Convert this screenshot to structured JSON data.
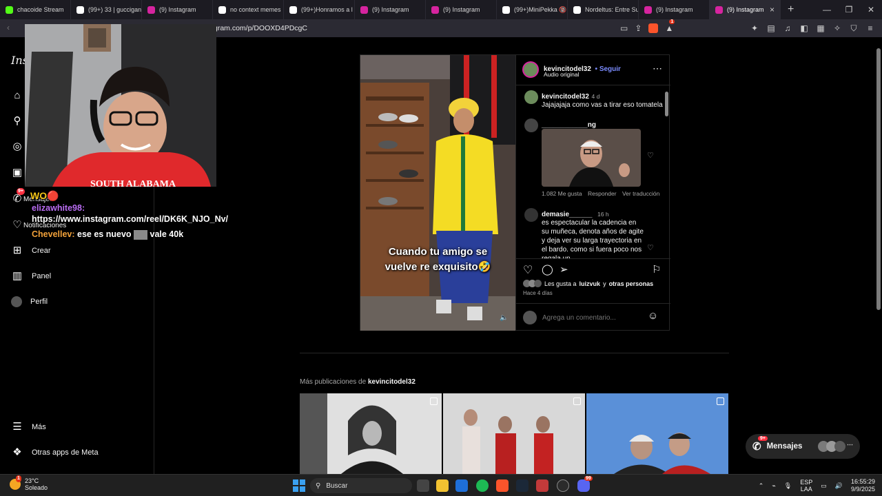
{
  "browser": {
    "tabs": [
      {
        "label": "chacoide Stream",
        "color": "#53fc18"
      },
      {
        "label": "(99+) 33 | guccigan",
        "color": "#ffffff"
      },
      {
        "label": "(9) Instagram",
        "color": "#d6249f"
      },
      {
        "label": "no context memes",
        "color": "#ffffff"
      },
      {
        "label": "(99+)Honramos a l",
        "color": "#ffffff"
      },
      {
        "label": "(9) Instagram",
        "color": "#d6249f"
      },
      {
        "label": "(9) Instagram",
        "color": "#d6249f"
      },
      {
        "label": "(99+)MiniPekka 🔞",
        "color": "#ffffff"
      },
      {
        "label": "Nordeltus: Entre Su",
        "color": "#ffffff"
      },
      {
        "label": "(9) Instagram",
        "color": "#d6249f"
      },
      {
        "label": "(9) Instagram",
        "color": "#d6249f",
        "active": true
      }
    ],
    "new_tab": "+",
    "url": "gram.com/p/DOOXD4PDcgC",
    "brave_badge": "1"
  },
  "sidebar": {
    "logo": "Ins",
    "items": [
      {
        "label": "",
        "icon": "home-icon",
        "glyph": "⌂"
      },
      {
        "label": "",
        "icon": "search-icon",
        "glyph": "⚲"
      },
      {
        "label": "",
        "icon": "explore-icon",
        "glyph": "◎"
      },
      {
        "label": "",
        "icon": "reels-icon",
        "glyph": "▣"
      },
      {
        "label": "Mensajes",
        "icon": "messages-icon",
        "glyph": "✆",
        "badge": "9+"
      },
      {
        "label": "Notificaciones",
        "icon": "heart-icon",
        "glyph": "♡"
      },
      {
        "label": "Crear",
        "icon": "create-icon",
        "glyph": "⊞"
      },
      {
        "label": "Panel",
        "icon": "dashboard-icon",
        "glyph": "▥"
      },
      {
        "label": "Perfil",
        "icon": "profile-avatar",
        "glyph": ""
      }
    ],
    "more": "Más",
    "meta_apps": "Otras apps de Meta"
  },
  "stream_chat": [
    {
      "user": "elizawhite98:",
      "msg": "https://www.instagram.com/reel/DK6K_NJO_Nv/"
    },
    {
      "user": "Chevellev:",
      "msg": "ese es nuevo",
      "msg2": "vale 40k"
    }
  ],
  "post": {
    "username": "kevincitodel32",
    "follow": "Seguir",
    "audio": "Audio original",
    "caption_overlay": [
      "Cuando tu amigo se",
      "vuelve re exquisito🤣"
    ],
    "comments": [
      {
        "user": "kevincitodel32",
        "time": "4 d",
        "text": "Jajajajaja como vas a tirar eso tomatela"
      },
      {
        "user": "____________ng",
        "likes": "1.082 Me gusta",
        "reply": "Responder",
        "translate": "Ver traducción"
      },
      {
        "user": "demasie______",
        "time": "16 h",
        "text": "es espectacular la cadencia en su muñeca, denota años de agite y deja ver su larga trayectoria en el bardo. como si fuera poco nos regala un"
      }
    ],
    "likes_prefix": "Les gusta a",
    "likes_user": "luizvuk",
    "likes_suffix": "y",
    "likes_others": "otras personas",
    "posted_ago": "Hace 4 días",
    "comment_placeholder": "Agrega un comentario..."
  },
  "more_posts": {
    "prefix": "Más publicaciones de",
    "user": "kevincitodel32"
  },
  "messages_pill": {
    "label": "Mensajes",
    "badge": "9+"
  },
  "taskbar": {
    "temp": "23°C",
    "weather": "Soleado",
    "weather_badge": "1",
    "search": "Buscar",
    "lang1": "ESP",
    "lang2": "LAA",
    "time": "16:55:29",
    "date": "9/9/2025",
    "discord_badge": "99"
  }
}
